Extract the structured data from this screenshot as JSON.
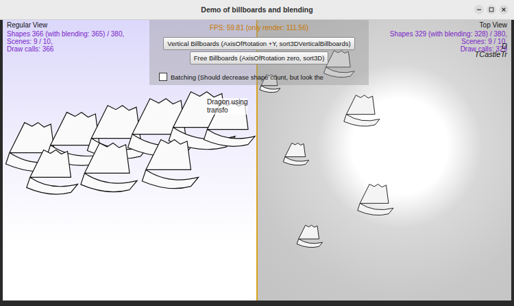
{
  "window": {
    "title": "Demo of billboards and blending"
  },
  "viewports": [
    {
      "title": "Regular View",
      "side": "left",
      "stats": [
        "Shapes 366 (with blending: 365) / 380,",
        "Scenes: 9 / 10,",
        "Draw calls: 366"
      ]
    },
    {
      "title": "Top View",
      "side": "right",
      "stats": [
        "Shapes 329 (with blending: 328) / 380,",
        "Scenes: 9 / 10,",
        "Draw calls: 329"
      ]
    }
  ],
  "scene_labels": {
    "regular": [
      "Dragon using",
      "transfo"
    ],
    "top": [
      "D",
      "TCastleTr"
    ]
  },
  "controls": {
    "fps": "FPS: 59.81 (only render: 111.56)",
    "buttons": [
      "Vertical Billboards (AxisOfRotation +Y, sort3DVerticalBillboards)",
      "Free Billboards (AxisOfRotation zero, sort3D)"
    ],
    "checkbox": {
      "label": "Batching (Should decrease shape count, but look the",
      "checked": false
    }
  }
}
